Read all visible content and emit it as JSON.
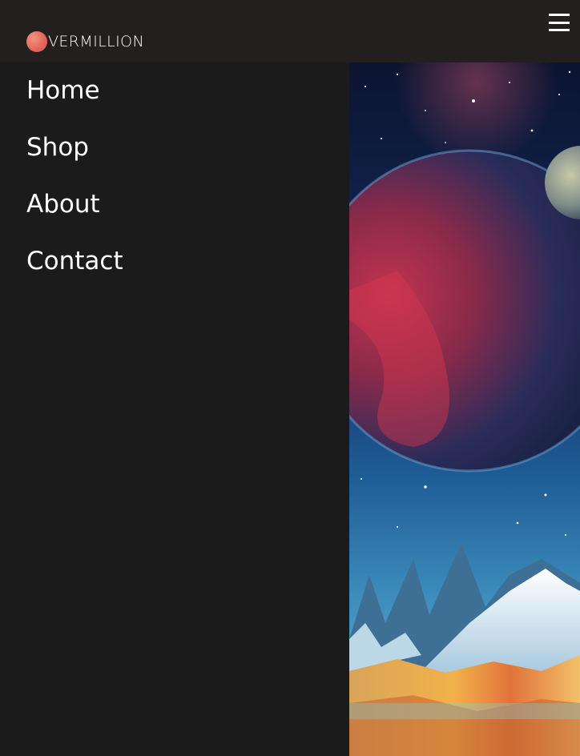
{
  "brand": {
    "name": "VERMILLION",
    "accent": "#e5685a"
  },
  "menu_toggle": {
    "icon": "hamburger-menu-icon"
  },
  "nav": {
    "items": [
      {
        "label": "Home"
      },
      {
        "label": "Shop"
      },
      {
        "label": "About"
      },
      {
        "label": "Contact"
      }
    ]
  },
  "hero": {
    "icon": "space-landscape-image"
  },
  "colors": {
    "topbar": "#221f1e",
    "sidebar": "#1b1b1b",
    "text": "#ffffff"
  }
}
